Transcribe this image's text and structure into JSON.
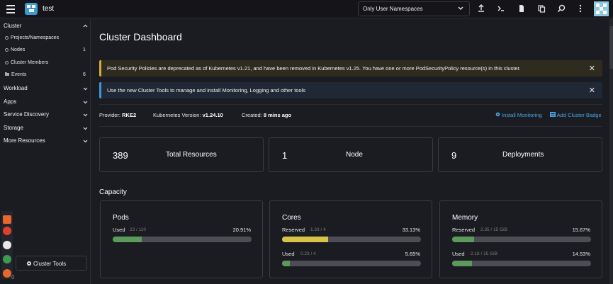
{
  "header": {
    "cluster_name": "test",
    "namespace_filter": "Only User Namespaces"
  },
  "sidebar": {
    "groups": [
      {
        "label": "Cluster",
        "items": [
          {
            "label": "Projects/Namespaces",
            "count": ""
          },
          {
            "label": "Nodes",
            "count": "1"
          },
          {
            "label": "Cluster Members",
            "count": ""
          },
          {
            "label": "Events",
            "count": "6"
          }
        ]
      },
      {
        "label": "Workload"
      },
      {
        "label": "Apps"
      },
      {
        "label": "Service Discovery"
      },
      {
        "label": "Storage"
      },
      {
        "label": "More Resources"
      }
    ],
    "cluster_tools_label": "Cluster Tools",
    "version": "0"
  },
  "main": {
    "title": "Cluster Dashboard",
    "banners": [
      {
        "type": "warning",
        "text": "Pod Security Policies are deprecated as of Kubernetes v1.21, and have been removed in Kubernetes v1.25. You have one or more PodSecurityPolicy resource(s) in this cluster."
      },
      {
        "type": "info",
        "text": "Use the new Cluster Tools to manage and install Monitoring, Logging and other tools"
      }
    ],
    "meta": {
      "provider_label": "Provider:",
      "provider": "RKE2",
      "k8s_label": "Kubernetes Version:",
      "k8s_version": "v1.24.10",
      "created_label": "Created:",
      "created": "8 mins ago"
    },
    "links": {
      "install_monitoring": "Install Monitoring",
      "add_badge": "Add Cluster Badge"
    },
    "stats": [
      {
        "value": "389",
        "label": "Total Resources"
      },
      {
        "value": "1",
        "label": "Node"
      },
      {
        "value": "9",
        "label": "Deployments"
      }
    ],
    "capacity_title": "Capacity",
    "capacity": [
      {
        "title": "Pods",
        "rows": [
          {
            "label": "Used",
            "detail": "23 / 110",
            "percent": "20.91%",
            "fraction": 0.2091,
            "color": "#5b9a5b"
          }
        ]
      },
      {
        "title": "Cores",
        "rows": [
          {
            "label": "Reserved",
            "detail": "1.33 / 4",
            "percent": "33.13%",
            "fraction": 0.3313,
            "color": "#d7c24a"
          },
          {
            "label": "Used",
            "detail": "0.23 / 4",
            "percent": "5.65%",
            "fraction": 0.0565,
            "color": "#5b9a5b"
          }
        ]
      },
      {
        "title": "Memory",
        "rows": [
          {
            "label": "Reserved",
            "detail": "2.35 / 15 GiB",
            "percent": "15.67%",
            "fraction": 0.1567,
            "color": "#5b9a5b"
          },
          {
            "label": "Used",
            "detail": "2.18 / 15 GiB",
            "percent": "14.53%",
            "fraction": 0.1453,
            "color": "#5b9a5b"
          }
        ]
      }
    ]
  },
  "colors": {
    "accent": "#3d98d3",
    "warning": "#d4ac3c",
    "success": "#5b9a5b",
    "reserved": "#d7c24a"
  }
}
